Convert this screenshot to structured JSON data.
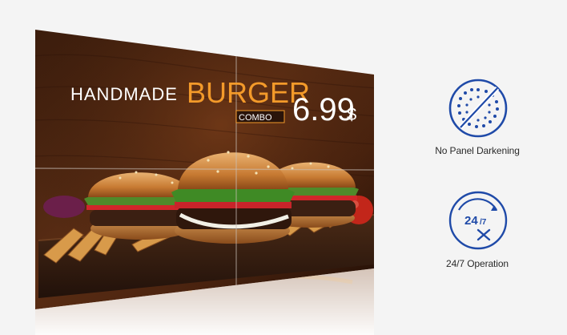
{
  "ad": {
    "headline": "HANDMADE",
    "product": "BURGER",
    "subline": "COMBO",
    "price": "6.99",
    "currency": "$"
  },
  "features": [
    {
      "icon": "no-panel-darkening-icon",
      "label": "No Panel Darkening"
    },
    {
      "icon": "24-7-operation-icon",
      "label": "24/7 Operation",
      "icon_text_main": "24",
      "icon_text_sub": "/7"
    }
  ],
  "colors": {
    "background": "#f4f4f4",
    "accent_blue": "#1f4aa8",
    "product_orange": "#f39a2a",
    "text_white": "#ffffff"
  }
}
